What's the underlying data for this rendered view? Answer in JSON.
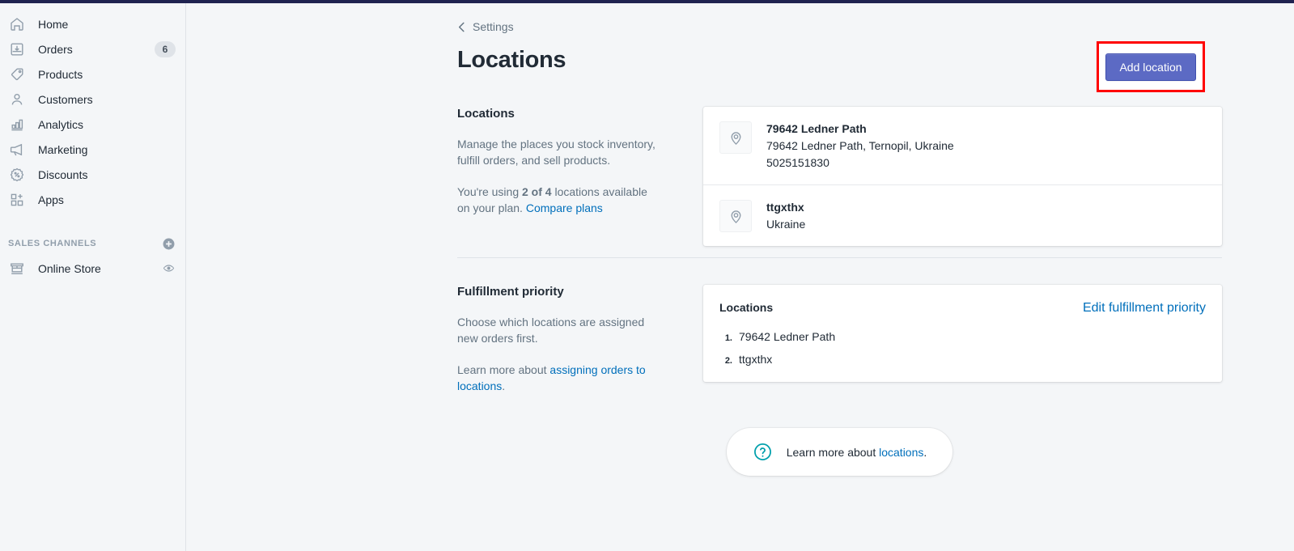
{
  "sidebar": {
    "items": [
      {
        "label": "Home",
        "icon": "home-icon",
        "badge": ""
      },
      {
        "label": "Orders",
        "icon": "orders-icon",
        "badge": "6"
      },
      {
        "label": "Products",
        "icon": "products-tag-icon",
        "badge": ""
      },
      {
        "label": "Customers",
        "icon": "customers-icon",
        "badge": ""
      },
      {
        "label": "Analytics",
        "icon": "analytics-bar-icon",
        "badge": ""
      },
      {
        "label": "Marketing",
        "icon": "marketing-megaphone-icon",
        "badge": ""
      },
      {
        "label": "Discounts",
        "icon": "discounts-percent-icon",
        "badge": ""
      },
      {
        "label": "Apps",
        "icon": "apps-grid-plus-icon",
        "badge": ""
      }
    ],
    "sales_channels": {
      "title": "SALES CHANNELS",
      "add_icon": "plus-circle-icon",
      "channels": [
        {
          "label": "Online Store",
          "icon": "storefront-icon",
          "action_icon": "eye-icon"
        }
      ]
    }
  },
  "header": {
    "breadcrumb": "Settings",
    "breadcrumb_icon": "chevron-left-icon",
    "title": "Locations",
    "primary_button": "Add location",
    "primary_button_color": "#5c6ac4",
    "highlight_color": "#ff0000"
  },
  "locations_section": {
    "heading": "Locations",
    "description": "Manage the places you stock inventory, fulfill orders, and sell products.",
    "usage_prefix": "You're using ",
    "usage_count": "2 of 4",
    "usage_suffix": " locations available on your plan. ",
    "compare_link": "Compare plans",
    "rows": [
      {
        "icon": "map-pin-icon",
        "name": "79642 Ledner Path",
        "address": "79642 Ledner Path, Ternopil, Ukraine",
        "phone": "5025151830"
      },
      {
        "icon": "map-pin-icon",
        "name": "ttgxthx",
        "address": "Ukraine",
        "phone": ""
      }
    ]
  },
  "fulfillment_section": {
    "heading": "Fulfillment priority",
    "description": "Choose which locations are assigned new orders first.",
    "learn_prefix": "Learn more about ",
    "learn_link": "assigning orders to locations",
    "learn_suffix": ".",
    "card_title": "Locations",
    "edit_link": "Edit fulfillment priority",
    "priority": [
      {
        "num": "1.",
        "name": "79642 Ledner Path"
      },
      {
        "num": "2.",
        "name": "ttgxthx"
      }
    ]
  },
  "help": {
    "icon": "question-circle-icon",
    "text_prefix": "Learn more about ",
    "link": "locations",
    "text_suffix": "."
  }
}
